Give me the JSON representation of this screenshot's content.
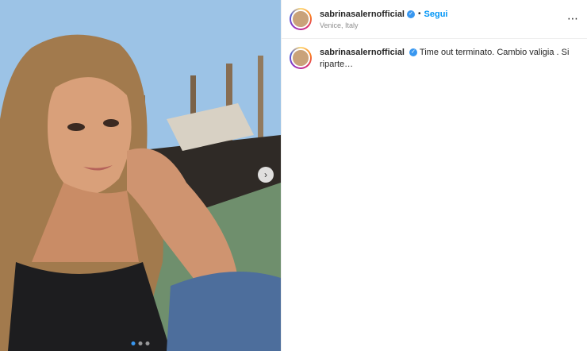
{
  "post": {
    "username": "sabrinasalernofficial",
    "verified_icon": "verified-badge-icon",
    "separator": "•",
    "follow_label": "Segui",
    "location": "Venice, Italy",
    "more_label": "⋯",
    "caption": "Time out terminato. Cambio valigia . Si riparte…",
    "media": {
      "next_label": "›",
      "carousel_count": 3,
      "carousel_active": 1
    }
  }
}
